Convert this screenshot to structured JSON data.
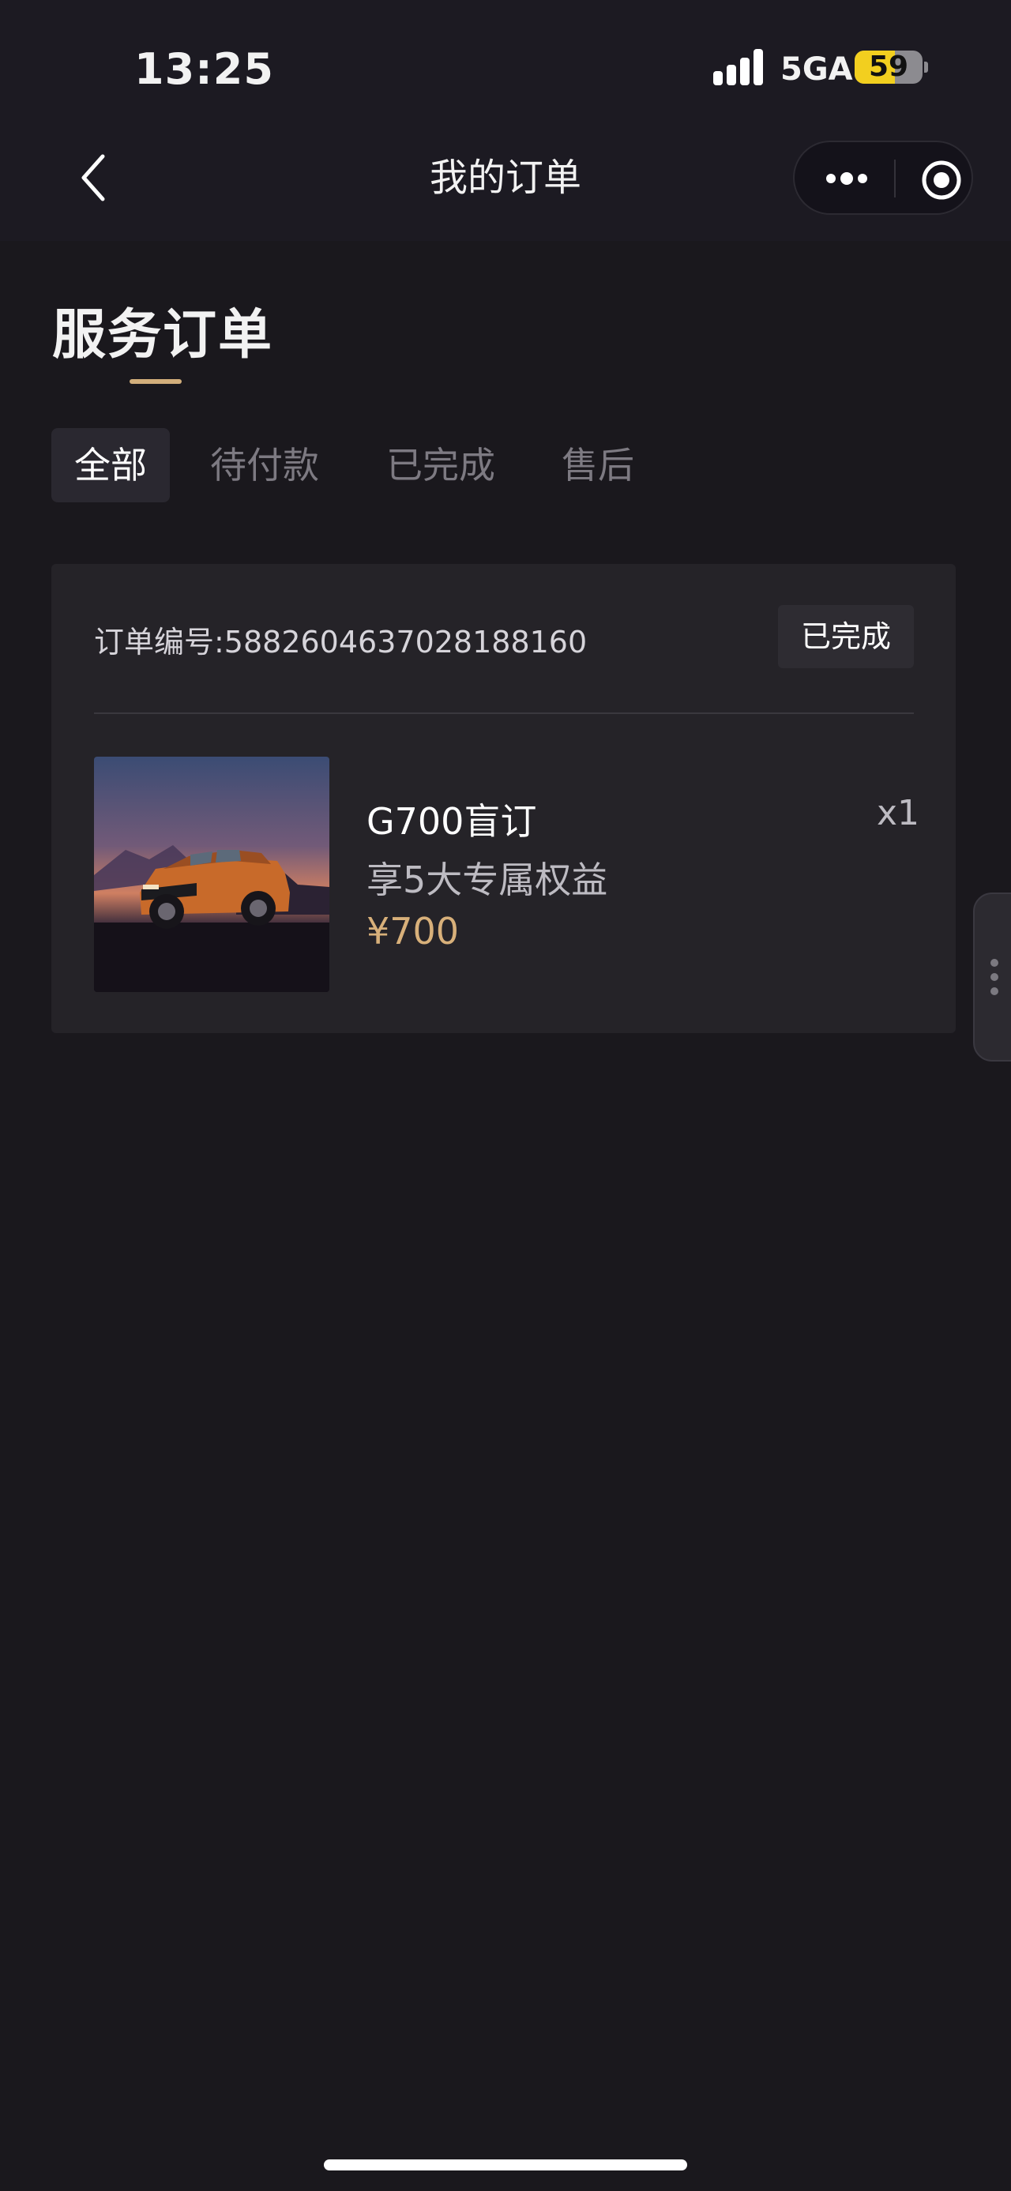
{
  "status_bar": {
    "time": "13:25",
    "network": "5GA",
    "battery": "59",
    "battery_level": 0.59
  },
  "nav": {
    "title": "我的订单",
    "back_icon": "chevron-left-icon",
    "more_icon": "more-dots-icon",
    "close_icon": "target-circle-icon"
  },
  "section": {
    "title": "服务订单",
    "accent_color": "#d2ae7b"
  },
  "tabs": [
    {
      "label": "全部",
      "active": true
    },
    {
      "label": "待付款",
      "active": false
    },
    {
      "label": "已完成",
      "active": false
    },
    {
      "label": "售后",
      "active": false
    }
  ],
  "order": {
    "number_label": "订单编号:5882604637028188160",
    "status": "已完成",
    "item": {
      "name": "G700盲订",
      "description": "享5大专属权益",
      "price": "¥700",
      "quantity": "x1",
      "image": "orange-suv-image"
    }
  },
  "colors": {
    "background": "#1a181d",
    "card": "#252328",
    "price": "#d8b07a"
  }
}
